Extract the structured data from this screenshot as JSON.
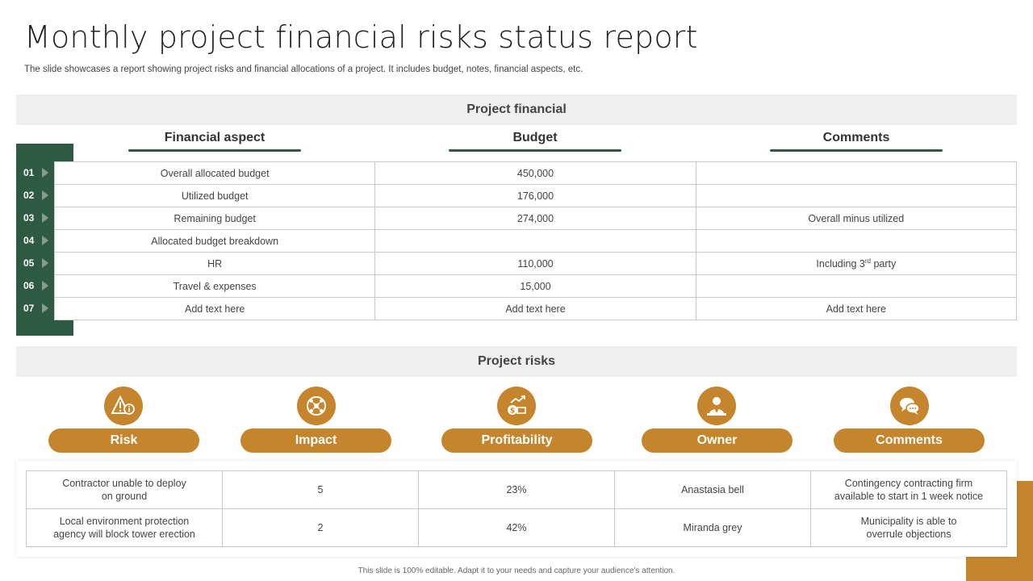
{
  "title": "Monthly project financial risks status report",
  "subtitle": "The slide showcases a report showing project risks and financial allocations of a project. It includes budget, notes, financial aspects, etc.",
  "financial": {
    "heading": "Project financial",
    "columns": [
      "Financial aspect",
      "Budget",
      "Comments"
    ],
    "rows": [
      {
        "num": "01",
        "aspect": "Overall allocated budget",
        "budget": "450,000",
        "comment": ""
      },
      {
        "num": "02",
        "aspect": "Utilized budget",
        "budget": "176,000",
        "comment": ""
      },
      {
        "num": "03",
        "aspect": "Remaining budget",
        "budget": "274,000",
        "comment": "Overall minus utilized"
      },
      {
        "num": "04",
        "aspect": "Allocated budget breakdown",
        "budget": "",
        "comment": ""
      },
      {
        "num": "05",
        "aspect": "HR",
        "budget": "110,000",
        "comment_pre": "Including 3",
        "comment_sup": "rd",
        "comment_post": " party"
      },
      {
        "num": "06",
        "aspect": "Travel & expenses",
        "budget": "15,000",
        "comment": ""
      },
      {
        "num": "07",
        "aspect": "Add text here",
        "budget": "Add text here",
        "comment": "Add text here"
      }
    ]
  },
  "risks": {
    "heading": "Project risks",
    "categories": [
      {
        "label": "Risk",
        "icon": "warning-icon"
      },
      {
        "label": "Impact",
        "icon": "impact-icon"
      },
      {
        "label": "Profitability",
        "icon": "money-growth-icon"
      },
      {
        "label": "Owner",
        "icon": "person-icon"
      },
      {
        "label": "Comments",
        "icon": "chat-bubbles-icon"
      }
    ],
    "rows": [
      {
        "risk": [
          "Contractor unable to deploy",
          "on ground"
        ],
        "impact": "5",
        "profitability": "23%",
        "owner": "Anastasia bell",
        "comments": [
          "Contingency contracting firm",
          "available to start in 1 week notice"
        ]
      },
      {
        "risk": [
          "Local environment protection",
          "agency will block tower erection"
        ],
        "impact": "2",
        "profitability": "42%",
        "owner": "Miranda grey",
        "comments": [
          "Municipality is able to",
          "overrule objections"
        ]
      }
    ]
  },
  "footer": "This slide is 100% editable. Adapt it to your needs and capture your audience's attention.",
  "colors": {
    "green": "#2e5a44",
    "gold": "#c5852d",
    "band": "#efefef"
  }
}
